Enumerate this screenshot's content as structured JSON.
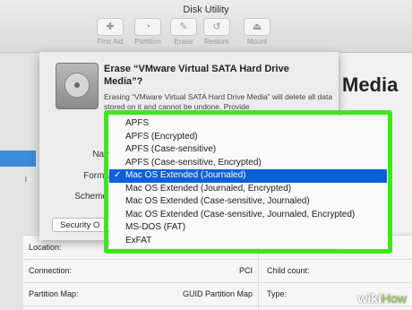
{
  "window": {
    "title": "Disk Utility"
  },
  "toolbar": [
    {
      "label": "First Aid",
      "icon": "stethoscope-icon"
    },
    {
      "label": "Partition",
      "icon": "pie-chart-icon"
    },
    {
      "label": "Erase",
      "icon": "erase-icon"
    },
    {
      "label": "Restore",
      "icon": "restore-icon"
    },
    {
      "label": "Mount",
      "icon": "mount-icon"
    }
  ],
  "background": {
    "title": "Media",
    "sidebar_text": "l"
  },
  "dialog": {
    "title": "Erase “VMware Virtual SATA Hard Drive Media”?",
    "description": "Erasing “VMware Virtual SATA Hard Drive Media” will delete all data stored on it and cannot be undone. Provide",
    "name_label": "Name",
    "format_label": "Forma",
    "scheme_label": "Scheme",
    "security_button": "Security O"
  },
  "format_menu": {
    "selected": "Mac OS Extended (Journaled)",
    "items": [
      "APFS",
      "APFS (Encrypted)",
      "APFS (Case-sensitive)",
      "APFS (Case-sensitive, Encrypted)",
      "Mac OS Extended (Journaled)",
      "Mac OS Extended (Journaled, Encrypted)",
      "Mac OS Extended (Case-sensitive, Journaled)",
      "Mac OS Extended (Case-sensitive, Journaled, Encrypted)",
      "MS-DOS (FAT)",
      "ExFAT"
    ],
    "highlight_color": "#3ce81c",
    "selection_color": "#0a60d8"
  },
  "info_table": {
    "rows": [
      {
        "left_label": "Location:",
        "left_value": "",
        "right_label": ""
      },
      {
        "left_label": "Connection:",
        "left_value": "PCI",
        "right_label": "Child count:"
      },
      {
        "left_label": "Partition Map:",
        "left_value": "GUID Partition Map",
        "right_label": "Type:"
      }
    ]
  },
  "watermark": {
    "wiki": "wiki",
    "how": "How"
  }
}
